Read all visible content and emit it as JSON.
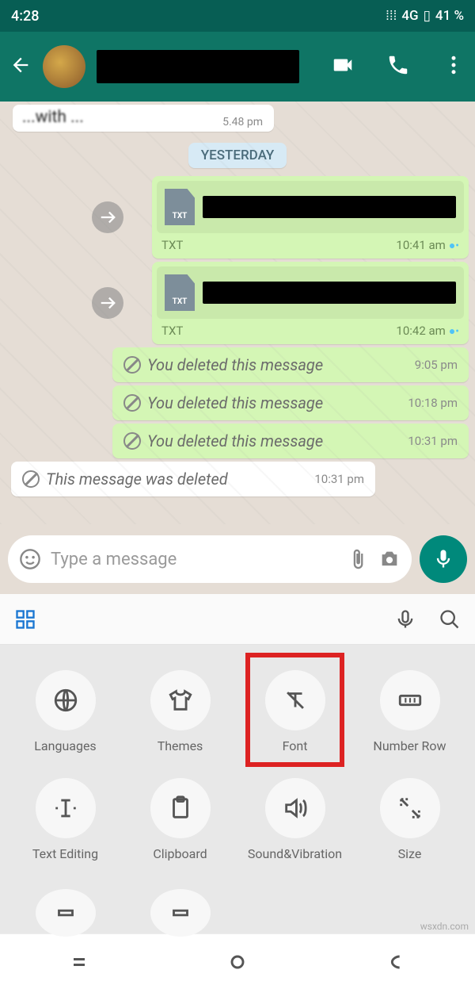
{
  "status": {
    "time": "4:28",
    "network": "4G",
    "battery": "41 %"
  },
  "partial": {
    "text": "...with ...",
    "time": "5.48 pm"
  },
  "date_badge": "YESTERDAY",
  "files": [
    {
      "ext": "TXT",
      "time": "10:41 am"
    },
    {
      "ext": "TXT",
      "time": "10:42 am"
    }
  ],
  "deleted_out": [
    {
      "text": "You deleted this message",
      "time": "9:05 pm"
    },
    {
      "text": "You deleted this message",
      "time": "10:18 pm"
    },
    {
      "text": "You deleted this message",
      "time": "10:31 pm"
    }
  ],
  "deleted_in": {
    "text": "This message was deleted",
    "time": "10:31 pm"
  },
  "input": {
    "placeholder": "Type a message"
  },
  "kb_items": [
    {
      "label": "Languages"
    },
    {
      "label": "Themes"
    },
    {
      "label": "Font"
    },
    {
      "label": "Number Row"
    },
    {
      "label": "Text Editing"
    },
    {
      "label": "Clipboard"
    },
    {
      "label": "Sound&Vibration"
    },
    {
      "label": "Size"
    }
  ],
  "watermark": "wsxdn.com"
}
